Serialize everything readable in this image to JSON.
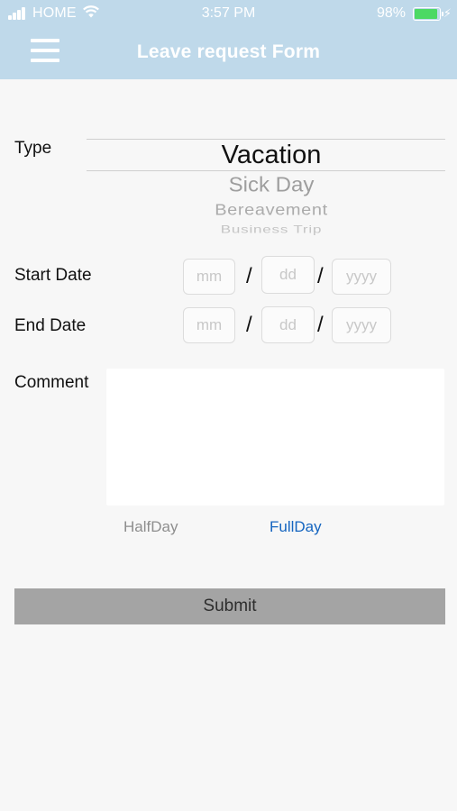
{
  "status_bar": {
    "carrier": "HOME",
    "time": "3:57 PM",
    "battery_percent": "98%",
    "battery_level": 0.98,
    "battery_color": "#4cd964"
  },
  "header": {
    "title": "Leave request Form",
    "menu_icon": "hamburger-menu-icon",
    "background": "#bfd9ea"
  },
  "form": {
    "type_label": "Type",
    "type_options": [
      "Vacation",
      "Sick Day",
      "Bereavement",
      "Business Trip"
    ],
    "type_selected": "Vacation",
    "start_date_label": "Start Date",
    "end_date_label": "End Date",
    "date_placeholders": {
      "month": "mm",
      "day": "dd",
      "year": "yyyy"
    },
    "date_separator": "/",
    "comment_label": "Comment",
    "comment_value": "",
    "duration_options": [
      "HalfDay",
      "FullDay"
    ],
    "duration_selected": "FullDay",
    "accent_color": "#1565c0",
    "submit_label": "Submit"
  }
}
